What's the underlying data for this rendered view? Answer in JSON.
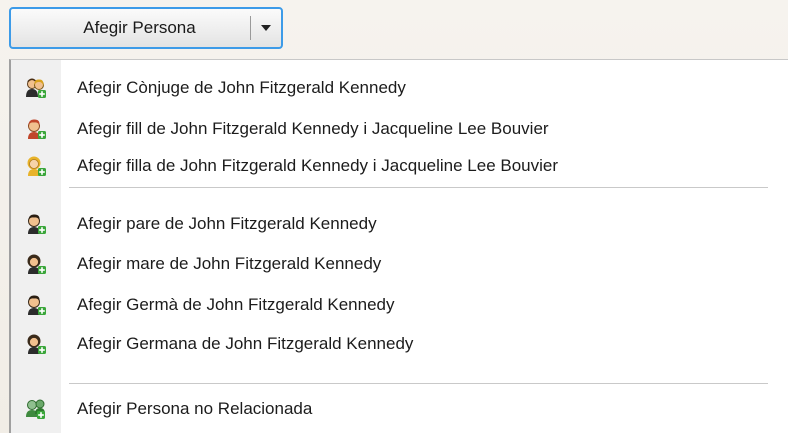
{
  "button": {
    "label": "Afegir Persona"
  },
  "menu": {
    "items": [
      {
        "label": "Afegir Cònjuge de John Fitzgerald Kennedy",
        "icon": "spouse-add-icon"
      },
      {
        "label": "Afegir fill de John Fitzgerald Kennedy i Jacqueline Lee Bouvier",
        "icon": "son-add-icon"
      },
      {
        "label": "Afegir filla de John Fitzgerald Kennedy i Jacqueline Lee Bouvier",
        "icon": "daughter-add-icon"
      },
      {
        "label": "Afegir pare de John Fitzgerald Kennedy",
        "icon": "father-add-icon"
      },
      {
        "label": "Afegir mare de John Fitzgerald Kennedy",
        "icon": "mother-add-icon"
      },
      {
        "label": "Afegir Germà de John Fitzgerald Kennedy",
        "icon": "brother-add-icon"
      },
      {
        "label": "Afegir Germana de John Fitzgerald Kennedy",
        "icon": "sister-add-icon"
      },
      {
        "label": "Afegir Persona no Relacionada",
        "icon": "unrelated-person-add-icon"
      }
    ]
  },
  "colors": {
    "focus_border": "#3d9be8",
    "plus_green": "#3aa63a",
    "skin": "#f1c08e"
  }
}
